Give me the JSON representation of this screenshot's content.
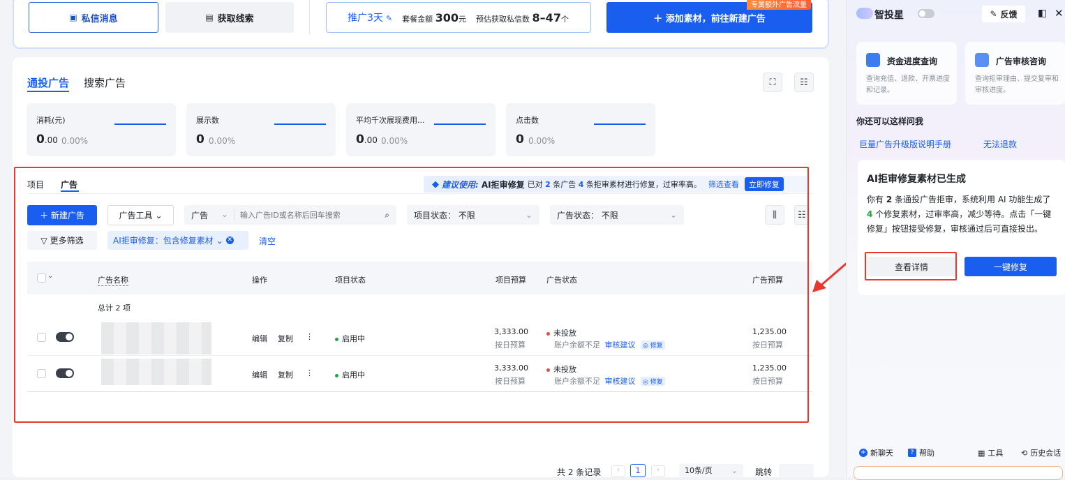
{
  "top": {
    "btn_private_msg": "私信消息",
    "btn_get_leads": "获取线索",
    "promo_days": "推广3天",
    "promo_amount_label": "套餐金额",
    "promo_amount_value": "300",
    "promo_amount_unit": "元",
    "promo_estimate_label": "预估获取私信数",
    "promo_estimate_value": "8–47",
    "promo_estimate_unit": "个",
    "add_material_btn": "＋ 添加素材，前往新建广告",
    "badge": "专属额外广告流量"
  },
  "panel": {
    "tabs": [
      "通投广告",
      "搜索广告"
    ],
    "metrics": [
      {
        "label": "消耗(元)",
        "value_int": "0",
        "value_dec": ".00",
        "pct": "0.00%"
      },
      {
        "label": "展示数",
        "value_int": "0",
        "value_dec": "",
        "pct": "0.00%"
      },
      {
        "label": "平均千次展现费用...",
        "value_int": "0",
        "value_dec": ".00",
        "pct": "0.00%"
      },
      {
        "label": "点击数",
        "value_int": "0",
        "value_dec": "",
        "pct": "0.00%"
      }
    ],
    "subtabs": [
      "项目",
      "广告"
    ],
    "suggest_label": "建议使用:",
    "suggest_title": "AI拒审修复",
    "suggest_text_pre": "已对",
    "suggest_num1": "2",
    "suggest_text_mid": "条广告",
    "suggest_num2": "4",
    "suggest_text_post": "条拒审素材进行修复，过审率高。",
    "suggest_filter": "筛选查看",
    "suggest_fix": "立即修复",
    "new_ad_btn": "＋ 新建广告",
    "ad_tools": "广告工具",
    "search_type": "广告",
    "search_placeholder": "输入广告ID或名称后回车搜索",
    "project_status_label": "项目状态：",
    "project_status_value": "不限",
    "ad_status_label": "广告状态：",
    "ad_status_value": "不限",
    "more_filter": "更多筛选",
    "filter_tag": "AI拒审修复：包含修复素材",
    "clear": "清空",
    "columns": [
      "广告名称",
      "操作",
      "项目状态",
      "项目预算",
      "广告状态",
      "广告预算"
    ],
    "total": "总计 2 项",
    "rows": [
      {
        "edit": "编辑",
        "copy": "复制",
        "more": "⋮",
        "project_status": "启用中",
        "budget": "3,333.00",
        "budget_type": "按日预算",
        "ad_status": "未投放",
        "ad_status_note": "账户余额不足",
        "review_link": "审核建议",
        "fix_tag": "修复",
        "ad_budget": "1,235.00",
        "ad_budget_type": "按日预算"
      },
      {
        "edit": "编辑",
        "copy": "复制",
        "more": "⋮",
        "project_status": "启用中",
        "budget": "3,333.00",
        "budget_type": "按日预算",
        "ad_status": "未投放",
        "ad_status_note": "账户余额不足",
        "review_link": "审核建议",
        "fix_tag": "修复",
        "ad_budget": "1,235.00",
        "ad_budget_type": "按日预算"
      }
    ],
    "pagination": {
      "total_text": "共 2 条记录",
      "page": "1",
      "page_size": "10条/页",
      "jump": "跳转"
    }
  },
  "sidebar": {
    "title": "智投星",
    "feedback": "反馈",
    "cards": [
      {
        "title": "资金进度查询",
        "desc": "查询充值、退款、开票进度和记录。"
      },
      {
        "title": "广告审核咨询",
        "desc": "查询拒审理由、提交复审和审核进度。"
      }
    ],
    "ask_title": "你还可以这样问我",
    "ask_links": [
      "巨量广告升级版说明手册",
      "无法退款"
    ],
    "ai_card_title": "AI拒审修复素材已生成",
    "ai_card_text_1": "你有",
    "ai_card_num1": "2",
    "ai_card_text_2": "条通投广告拒审，系统利用 AI 功能生成了",
    "ai_card_num2": "4",
    "ai_card_text_3": "个修复素材，过审率高，减少等待。点击「一键修复」按钮接受修复，审核通过后可直接投出。",
    "view_detail": "查看详情",
    "one_click_fix": "一键修复",
    "footer": [
      "新聊天",
      "帮助",
      "工具",
      "历史会话"
    ]
  },
  "colors": {
    "primary": "#1a5ef0",
    "annotation_red": "#e9392f",
    "success": "#22a447"
  }
}
